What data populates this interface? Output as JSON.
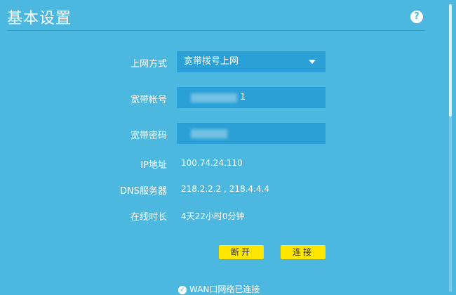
{
  "header": {
    "title": "基本设置",
    "help_glyph": "?"
  },
  "form": {
    "connection_type": {
      "label": "上网方式",
      "value": "宽带拨号上网"
    },
    "account": {
      "label": "宽带帐号",
      "visible_tail": "1"
    },
    "password": {
      "label": "宽带密码"
    },
    "ip": {
      "label": "IP地址",
      "value": "100.74.24.110"
    },
    "dns": {
      "label": "DNS服务器",
      "value": "218.2.2.2 , 218.4.4.4"
    },
    "uptime": {
      "label": "在线时长",
      "value": "4天22小时0分钟"
    }
  },
  "buttons": {
    "disconnect": "断开",
    "connect": "连接"
  },
  "status": {
    "text": "WAN口网络已连接"
  },
  "colors": {
    "background": "#4cb8e0",
    "input_bg": "#2aa0d6",
    "button_bg": "#ffe600"
  },
  "icons": {
    "help": "help-icon",
    "dropdown": "chevron-down-icon",
    "status": "check-circle-icon"
  }
}
